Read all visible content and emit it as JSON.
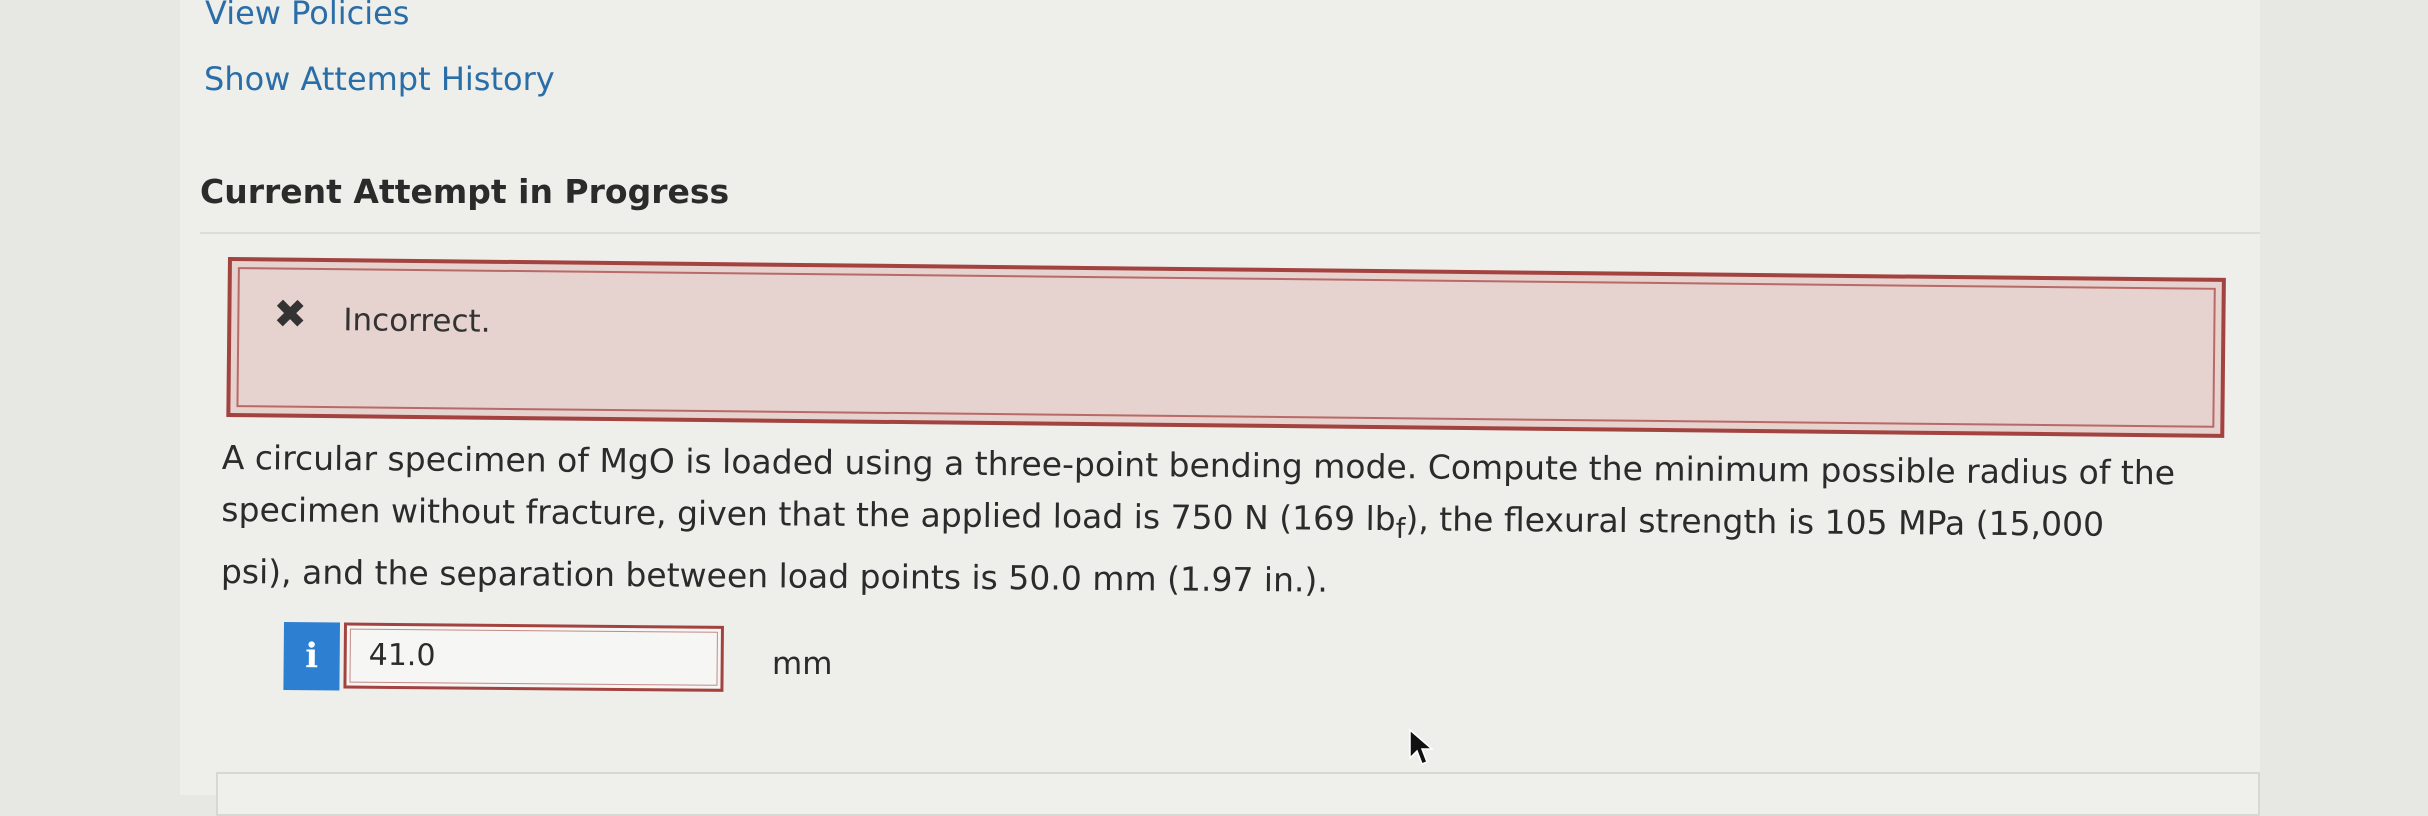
{
  "links": {
    "view_policies": "View Policies",
    "show_attempt_history": "Show Attempt History"
  },
  "section": {
    "title": "Current Attempt in Progress"
  },
  "feedback": {
    "icon": "close-icon",
    "icon_glyph": "✖",
    "text": "Incorrect.",
    "color": "#a34340"
  },
  "question": {
    "text_part1": "A circular specimen of MgO is loaded using a three-point bending mode. Compute the minimum possible radius of the specimen without fracture, given that the applied load is 750 N (169 lb",
    "subscript": "f",
    "text_part2": "), the flexural strength is 105 MPa (15,000 psi), and the separation between load points is 50.0 mm (1.97 in.)."
  },
  "answer": {
    "info_glyph": "i",
    "value": "41.0",
    "unit": "mm"
  },
  "colors": {
    "link": "#2a6ea8",
    "info_button": "#2d7fd1"
  }
}
